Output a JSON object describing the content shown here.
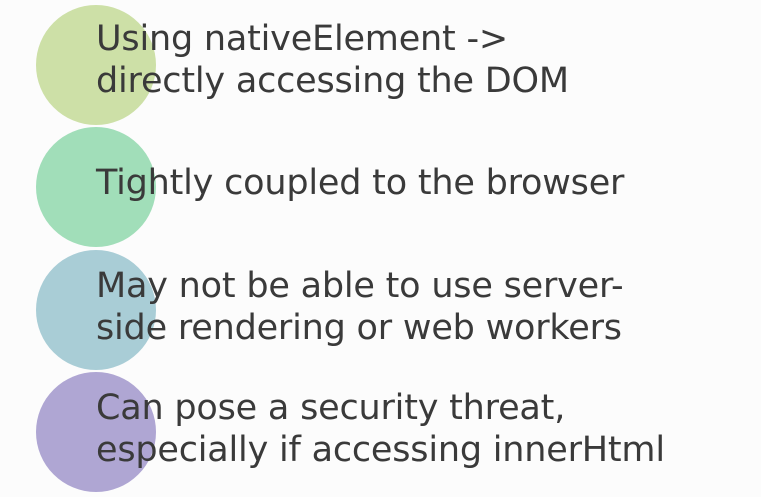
{
  "slide": {
    "points": [
      {
        "lines": [
          "Using nativeElement ->",
          "directly accessing the DOM"
        ],
        "color": "#cde0a7"
      },
      {
        "lines": [
          "Tightly coupled to the browser"
        ],
        "color": "#a1deb9"
      },
      {
        "lines": [
          "May not be able to use server-",
          "side rendering or web workers"
        ],
        "color": "#a9cdd6"
      },
      {
        "lines": [
          "Can pose a security threat,",
          "especially if accessing innerHtml"
        ],
        "color": "#afa6d3"
      }
    ]
  }
}
